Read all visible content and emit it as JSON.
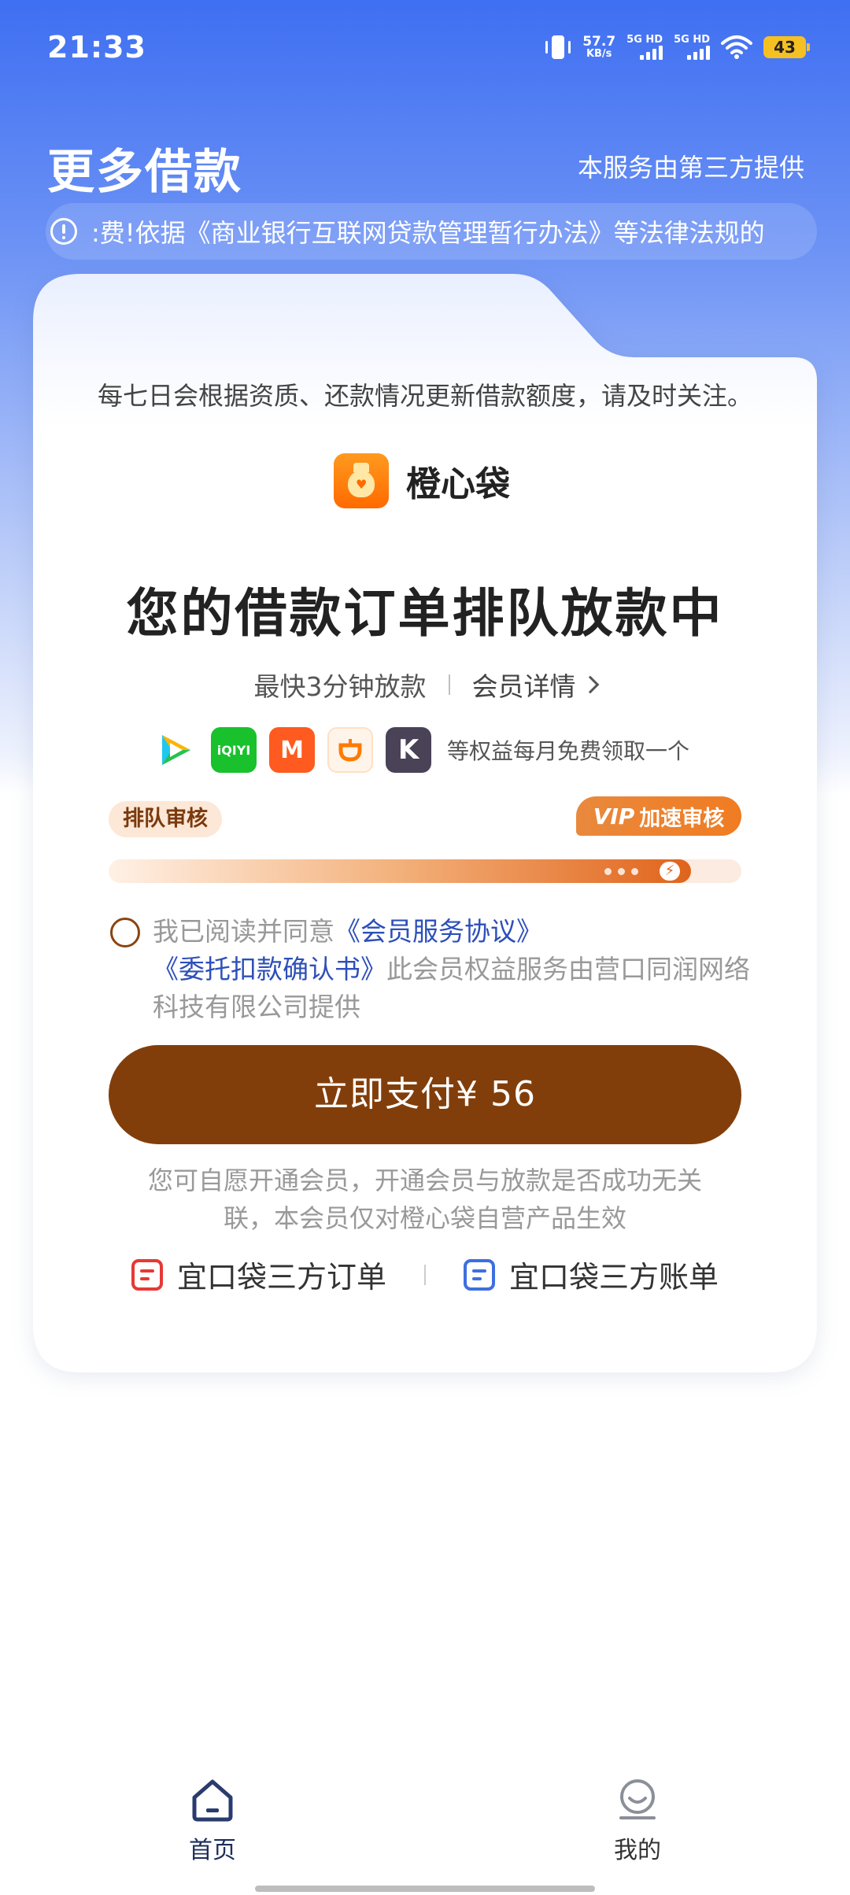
{
  "status_bar": {
    "time": "21:33",
    "net_speed_value": "57.7",
    "net_speed_unit": "KB/s",
    "sim1_label": "5G HD",
    "sim2_label": "5G HD",
    "battery": "43"
  },
  "header": {
    "title": "更多借款",
    "provider_note": "本服务由第三方提供",
    "notice": ":费!依据《商业银行互联网贷款管理暂行办法》等法律法规的"
  },
  "card": {
    "refresh_note": "每七日会根据资质、还款情况更新借款额度，请及时关注。",
    "brand_name": "橙心袋",
    "main_title": "您的借款订单排队放款中",
    "fast_release": "最快3分钟放款",
    "member_details": "会员详情",
    "perk_apps": [
      {
        "name": "tencent-video-icon",
        "color": "#1fc8f0"
      },
      {
        "name": "iqiyi-icon",
        "color": "#19c12d",
        "text": "iQIYI"
      },
      {
        "name": "mango-tv-icon",
        "color": "#ff5a1f",
        "text": "M"
      },
      {
        "name": "didi-icon",
        "color": "#ff7a00"
      },
      {
        "name": "keep-icon",
        "color": "#4a4257",
        "text": "K"
      }
    ],
    "perks_text": "等权益每月免费领取一个",
    "queue_label": "排队审核",
    "vip_mark": "VIP",
    "vip_label": "加速审核",
    "progress": 0.92,
    "agree_prefix": "我已阅读并同意",
    "agree_link1": "《会员服务协议》",
    "agree_link2": "《委托扣款确认书》",
    "agree_suffix": "此会员权益服务由营口同润网络科技有限公司提供",
    "pay_button": "立即支付¥ 56",
    "disclaimer": "您可自愿开通会员，开通会员与放款是否成功无关联，本会员仅对橙心袋自营产品生效",
    "order_link": "宜口袋三方订单",
    "bill_link": "宜口袋三方账单"
  },
  "bottom_nav": {
    "home": "首页",
    "mine": "我的"
  },
  "colors": {
    "header_blue": "#3f6ff2",
    "pay_brown": "#823e0a",
    "link_blue": "#2d4fb9",
    "brand_orange": "#ff7a00"
  }
}
